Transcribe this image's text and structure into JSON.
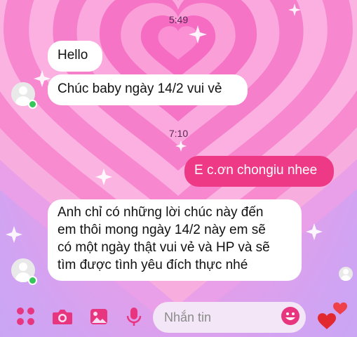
{
  "chat": {
    "messages": [
      {
        "type": "timestamp",
        "text": "5:49"
      },
      {
        "type": "in",
        "text": "Hello"
      },
      {
        "type": "in",
        "text": "Chúc baby ngày 14/2 vui vẻ"
      },
      {
        "type": "timestamp",
        "text": "7:10"
      },
      {
        "type": "out",
        "text": "E c.ơn chongiu nhee"
      },
      {
        "type": "in",
        "lines": [
          "Anh chỉ có những lời chúc này đến",
          "em thôi mong ngày 14/2 này em sẽ",
          "có một ngày thật vui vẻ và HP và sẽ",
          "tìm được tình yêu đích thực nhé"
        ]
      }
    ]
  },
  "composer": {
    "placeholder": "Nhắn tin",
    "icons": [
      "apps-grid-icon",
      "camera-icon",
      "gallery-icon",
      "microphone-icon",
      "emoji-icon",
      "hearts-icon"
    ]
  },
  "colors": {
    "accent": "#ee3a86",
    "icon": "#e8357f",
    "online": "#35c759",
    "bubble_in": "#ffffff"
  }
}
